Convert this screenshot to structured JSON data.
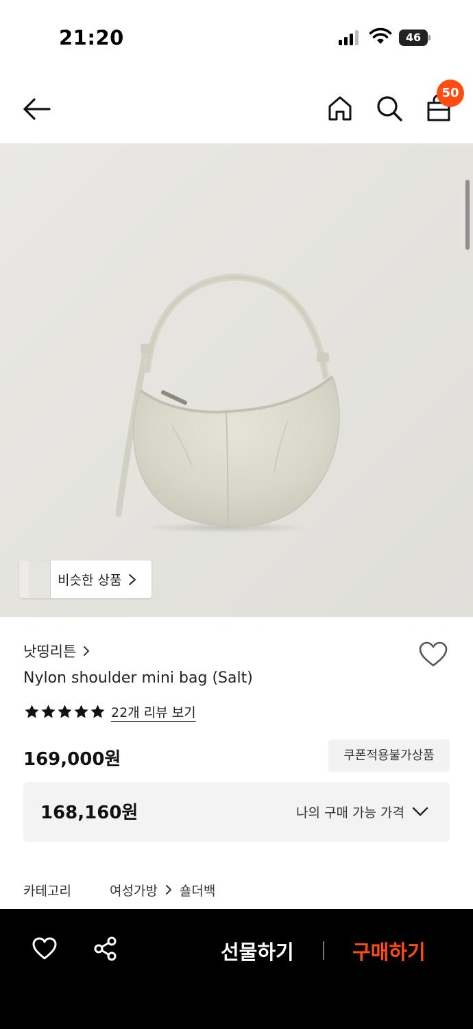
{
  "status_bar": {
    "time": "21:20",
    "battery": "46"
  },
  "nav": {
    "cart_count": "50"
  },
  "similar_button": {
    "label": "비슷한 상품"
  },
  "product": {
    "brand": "낫띵리튼",
    "name": "Nylon shoulder mini bag (Salt)",
    "rating": 5,
    "rating_max": 5,
    "review_link": "22개 리뷰 보기",
    "price": "169,000원",
    "coupon_badge": "쿠폰적용불가상품",
    "my_price": "168,160원",
    "my_price_label": "나의 구매 가능 가격"
  },
  "category": {
    "label": "카테고리",
    "path": [
      "여성가방",
      "숄더백"
    ]
  },
  "bottom_bar": {
    "gift_label": "선물하기",
    "buy_label": "구매하기",
    "accent_color": "#ff4d12"
  },
  "icons": {
    "back": "arrow-left-icon",
    "home": "home-icon",
    "search": "search-icon",
    "cart": "shopping-bag-icon",
    "wish": "heart-icon",
    "share": "share-icon"
  }
}
